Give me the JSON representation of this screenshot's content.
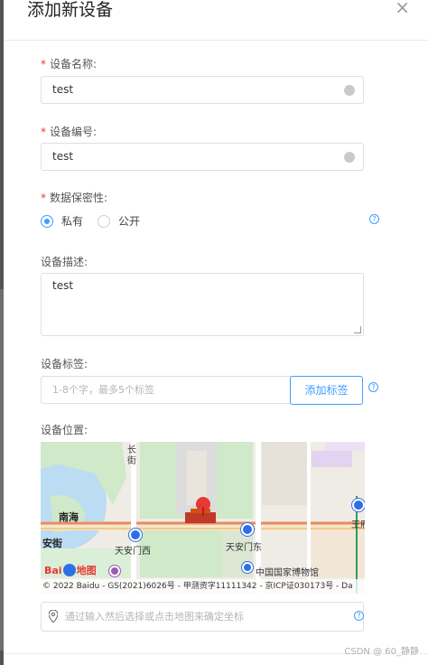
{
  "dialog": {
    "title": "添加新设备",
    "close": "×"
  },
  "form": {
    "name": {
      "label": "设备名称:",
      "required": "*",
      "value": "test"
    },
    "code": {
      "label": "设备编号:",
      "required": "*",
      "value": "test"
    },
    "privacy": {
      "label": "数据保密性:",
      "required": "*",
      "options": [
        "私有",
        "公开"
      ],
      "selected": "私有",
      "help": "?"
    },
    "description": {
      "label": "设备描述:",
      "value": "test"
    },
    "tags": {
      "label": "设备标签:",
      "placeholder": "1-8个字，最多5个标签",
      "add_button": "添加标签",
      "help": "?"
    },
    "location": {
      "label": "设备位置:",
      "placeholder": "通过输入然后选择或点击地图来确定坐标",
      "help": "?"
    }
  },
  "map": {
    "labels": {
      "nanhai": "南海",
      "anjie": "安街",
      "tiananmen_west": "天安门西",
      "tiananmen_east": "天安门东",
      "museum": "中国国家博物馆",
      "wangfu": "王府",
      "jie": "街",
      "chang": "长"
    },
    "logo": {
      "bai": "Bai",
      "du": "du",
      "map": "地图"
    },
    "copyright": "© 2022 Baidu - GS(2021)6026号 - 甲测资字11111342 - 京ICP证030173号 - Da"
  },
  "watermark": "CSDN @ 60_静静"
}
